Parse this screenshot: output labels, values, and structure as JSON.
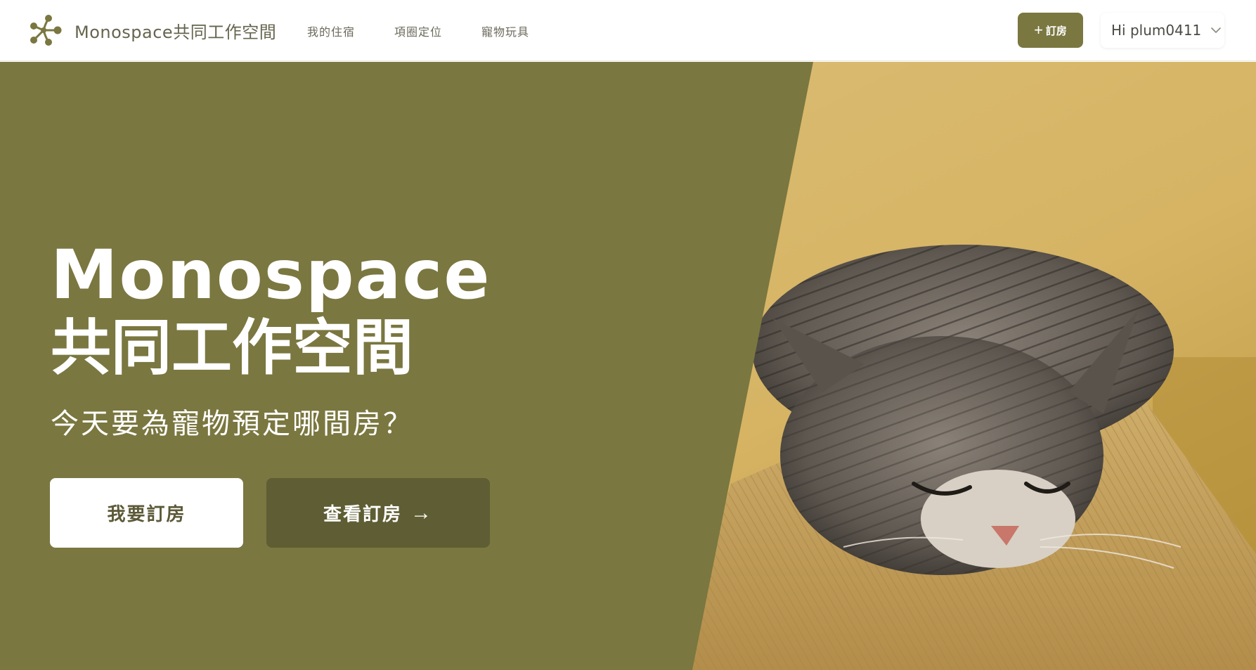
{
  "header": {
    "brand": {
      "logo_icon": "molecule-dots-logo-icon",
      "name": "Monospace共同工作空間"
    },
    "nav": [
      {
        "label": "我的住宿"
      },
      {
        "label": "項圈定位"
      },
      {
        "label": "寵物玩具"
      }
    ],
    "book_button": {
      "icon": "plus-icon",
      "plus": "+",
      "label": "訂房"
    },
    "user_menu": {
      "greeting": "Hi plum0411",
      "icon": "chevron-down-icon"
    }
  },
  "hero": {
    "title_line1": "Monospace",
    "title_line2": "共同工作空間",
    "subtitle": "今天要為寵物預定哪間房？",
    "primary_button": "我要訂房",
    "secondary_button": "查看訂房",
    "secondary_arrow": "→",
    "image": {
      "subject": "sleeping tabby cat on a corduroy sofa arm",
      "icon": "cat-photo"
    }
  },
  "colors": {
    "brand_olive": "#7a7740",
    "dark_olive": "#5f5d33",
    "background": "#ffffff",
    "photo_wall": "#d9b86a",
    "sofa": "#c9a55c"
  }
}
